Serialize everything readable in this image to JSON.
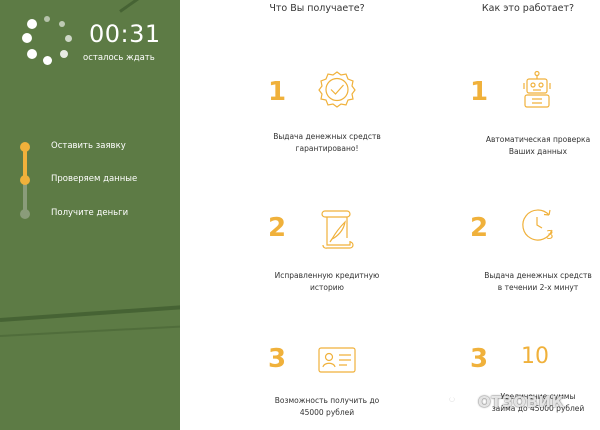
{
  "sidebar": {
    "timer": "00:31",
    "timer_caption": "осталось ждать",
    "steps": [
      {
        "label": "Оставить заявку",
        "state": "done"
      },
      {
        "label": "Проверяем данные",
        "state": "active"
      },
      {
        "label": "Получите деньги",
        "state": "pending"
      }
    ],
    "colors": {
      "background": "#5d7b45",
      "active": "#f0b13b",
      "pending": "#8a9c7a"
    }
  },
  "columns": {
    "left_title": "Что Вы получаете?",
    "right_title": "Как это работает?"
  },
  "benefits": [
    {
      "number": "1",
      "icon": "guarantee-seal-icon",
      "text_line1": "Выдача денежных средств",
      "text_line2": "гарантировано!"
    },
    {
      "number": "2",
      "icon": "scroll-quill-icon",
      "text_line1": "Исправленную кредитную",
      "text_line2": "историю"
    },
    {
      "number": "3",
      "icon": "id-card-icon",
      "text_line1": "Возможность получить до",
      "text_line2": "45000 рублей"
    }
  ],
  "process": [
    {
      "number": "1",
      "icon": "robot-icon",
      "text_line1": "Автоматическая проверка",
      "text_line2": "Ваших данных"
    },
    {
      "number": "2",
      "icon": "clock-three-icon",
      "text_line1": "Выдача денежных средств",
      "text_line2": "в течении 2-х минут"
    },
    {
      "number": "3",
      "icon_text": "10",
      "icon": "ten-icon",
      "text_line1": "Увеличение суммы",
      "text_line2": "займа до 45000 рублей"
    }
  ],
  "watermark": {
    "text": "ОТЗОВИК",
    "icon": "power-icon"
  },
  "accent_color": "#f0b13b"
}
